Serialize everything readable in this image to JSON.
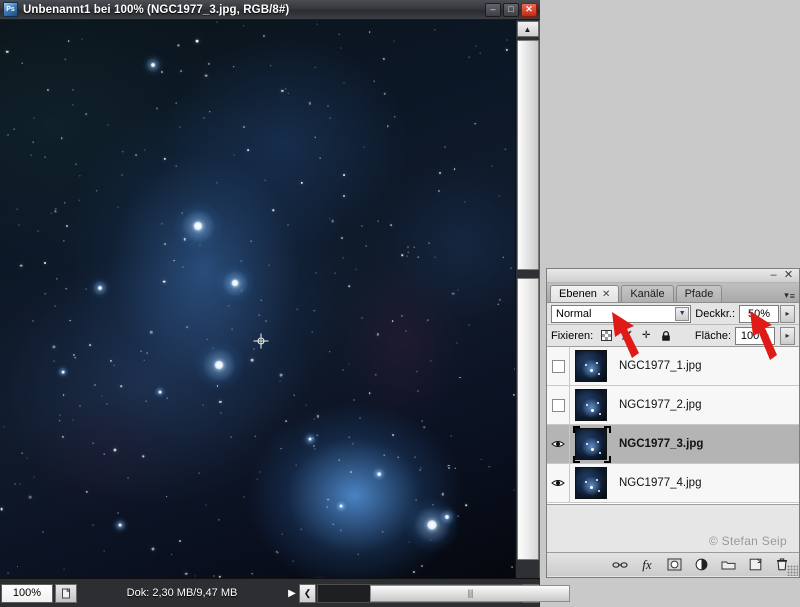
{
  "document_window": {
    "title": "Unbenannt1 bei 100% (NGC1977_3.jpg, RGB/8#)",
    "app_icon": "Ps",
    "controls": {
      "minimize": "–",
      "maximize": "□",
      "close": "✕"
    },
    "status_bar": {
      "zoom": "100%",
      "doc_info": "Dok: 2,30 MB/9,47 MB",
      "play_arrow": "▶",
      "scroll_left": "❮",
      "scroll_right": "❯",
      "grip": "||||"
    },
    "scrollbar": {
      "up": "▲",
      "down": "▼"
    }
  },
  "layers_panel": {
    "window_controls": {
      "minimize": "–",
      "close": "✕"
    },
    "menu_icon": "≡",
    "menu_caret": "▾",
    "tabs": [
      {
        "label": "Ebenen",
        "closable": true,
        "close_glyph": "✕",
        "active": true
      },
      {
        "label": "Kanäle",
        "closable": false,
        "close_glyph": "",
        "active": false
      },
      {
        "label": "Pfade",
        "closable": false,
        "close_glyph": "",
        "active": false
      }
    ],
    "blend_mode": {
      "value": "Normal",
      "arrow": "▼"
    },
    "opacity": {
      "label": "Deckkr.:",
      "value": "50%",
      "spinner": "▸"
    },
    "lock": {
      "label": "Fixieren:",
      "icons": [
        "transparency-checker",
        "brush",
        "move-cross",
        "padlock"
      ],
      "brush_glyph": "✐",
      "move_glyph": "✛",
      "lock_glyph": "■"
    },
    "fill": {
      "label": "Fläche:",
      "value": "100%",
      "spinner": "▸"
    },
    "layers": [
      {
        "name": "NGC1977_1.jpg",
        "visible": false,
        "selected": false
      },
      {
        "name": "NGC1977_2.jpg",
        "visible": false,
        "selected": false
      },
      {
        "name": "NGC1977_3.jpg",
        "visible": true,
        "selected": true
      },
      {
        "name": "NGC1977_4.jpg",
        "visible": true,
        "selected": false
      }
    ],
    "eye_glyph": "ʘ",
    "copyright": "© Stefan Seip",
    "footer_buttons": [
      {
        "name": "link-layers",
        "glyph": "∞"
      },
      {
        "name": "layer-styles-fx",
        "glyph": "fx"
      },
      {
        "name": "add-layer-mask",
        "glyph": "□"
      },
      {
        "name": "new-adjustment-layer",
        "glyph": "◑"
      },
      {
        "name": "new-group-folder",
        "glyph": "▭"
      },
      {
        "name": "new-layer",
        "glyph": "❐"
      },
      {
        "name": "delete-layer",
        "glyph": "⌧"
      }
    ]
  },
  "annotations": {
    "arrow_color": "#e01b17",
    "arrows": [
      {
        "name": "arrow-to-blend-mode",
        "points_at": "blend-mode-dropdown"
      },
      {
        "name": "arrow-to-opacity",
        "points_at": "opacity-field"
      }
    ]
  },
  "canvas": {
    "alt": "NGC 1977 Running Man Nebula astrophotograph",
    "cursor": "crosshair-cursor"
  }
}
